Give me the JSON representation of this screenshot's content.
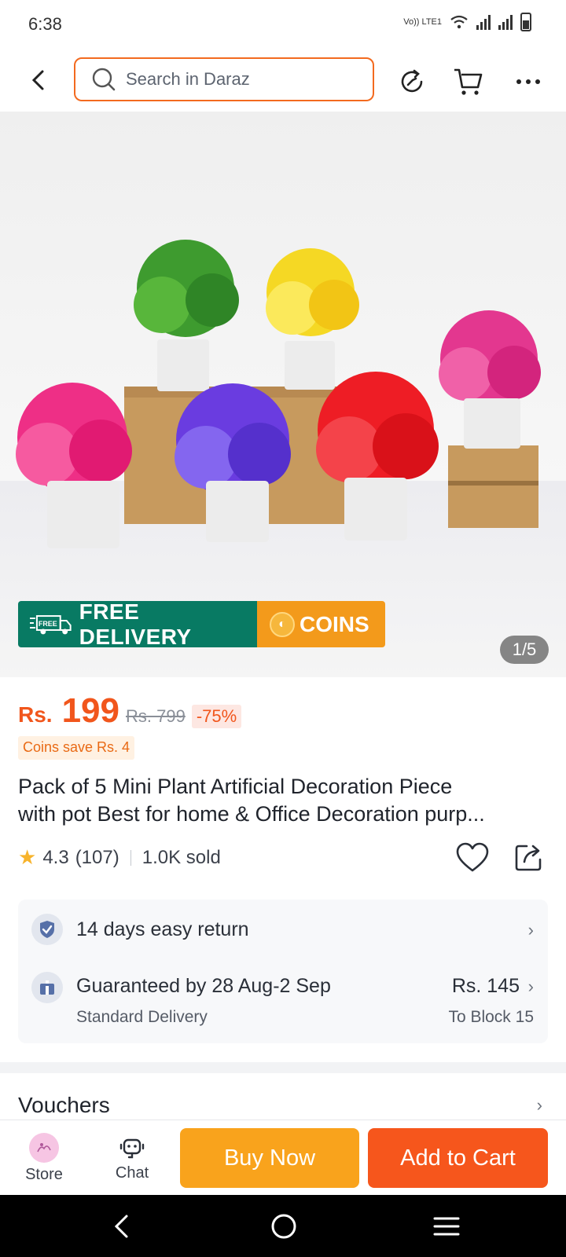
{
  "status_bar": {
    "time": "6:38",
    "network_label": "Vo)) LTE1"
  },
  "header": {
    "search_placeholder": "Search in Daraz"
  },
  "gallery": {
    "page_indicator": "1/5",
    "promo": {
      "free_label": "FREE DELIVERY",
      "truck_text": "FREE",
      "coins_label": "COINS"
    }
  },
  "product": {
    "currency": "Rs.",
    "price": "199",
    "old_price": "Rs. 799",
    "discount": "-75%",
    "coins_save": "Coins save Rs. 4",
    "title_line1": "Pack of 5 Mini Plant Artificial Decoration Piece",
    "title_line2": "with pot Best for home & Office Decoration purp...",
    "rating": "4.3",
    "reviews": "(107)",
    "sold": "1.0K sold"
  },
  "services": {
    "returns": "14 days easy return",
    "delivery_title": "Guaranteed by 28 Aug-2 Sep",
    "delivery_sub": "Standard Delivery",
    "delivery_fee": "Rs. 145",
    "delivery_location": "To Block 15"
  },
  "vouchers": {
    "label": "Vouchers"
  },
  "action_bar": {
    "store_label": "Store",
    "chat_label": "Chat",
    "buy_label": "Buy Now",
    "cart_label": "Add to Cart"
  },
  "colors": {
    "brand_orange": "#f1561c",
    "buy_yellow": "#f9a31c",
    "delivery_green": "#087a63",
    "coins_orange": "#f39a1b"
  }
}
